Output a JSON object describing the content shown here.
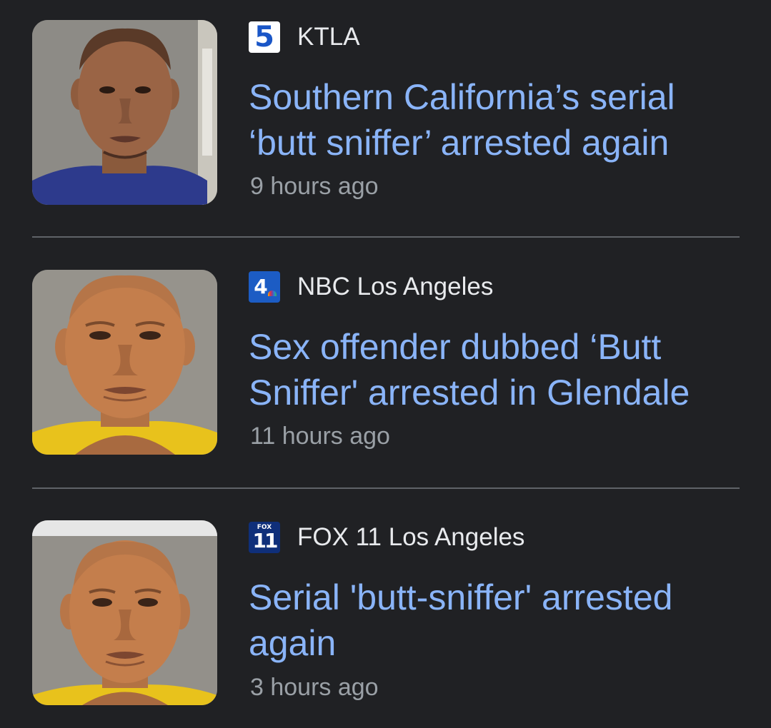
{
  "articles": [
    {
      "source": "KTLA",
      "source_logo_icon": "ktla-5-logo-icon",
      "source_logo_text": "5",
      "headline": "Southern California’s serial ‘butt sniffer’ arrested again",
      "time": "9 hours ago",
      "thumbnail_icon": "mugshot-photo",
      "shirt_color": "#2d3a8c"
    },
    {
      "source": "NBC Los Angeles",
      "source_logo_icon": "nbc-4-logo-icon",
      "source_logo_text": "4",
      "headline": "Sex offender dubbed ‘Butt Sniffer' arrested in Glendale",
      "time": "11 hours ago",
      "thumbnail_icon": "mugshot-photo",
      "shirt_color": "#e8c21c"
    },
    {
      "source": "FOX 11 Los Angeles",
      "source_logo_icon": "fox-11-logo-icon",
      "source_logo_text": "11",
      "source_logo_small": "FOX",
      "headline": "Serial 'butt-sniffer' arrested again",
      "time": "3 hours ago",
      "thumbnail_icon": "mugshot-photo",
      "shirt_color": "#e8c21c"
    }
  ],
  "colors": {
    "background": "#202124",
    "headline": "#8ab4f8",
    "source": "#e8eaed",
    "timestamp": "#9aa0a6",
    "divider": "#5f6368"
  }
}
